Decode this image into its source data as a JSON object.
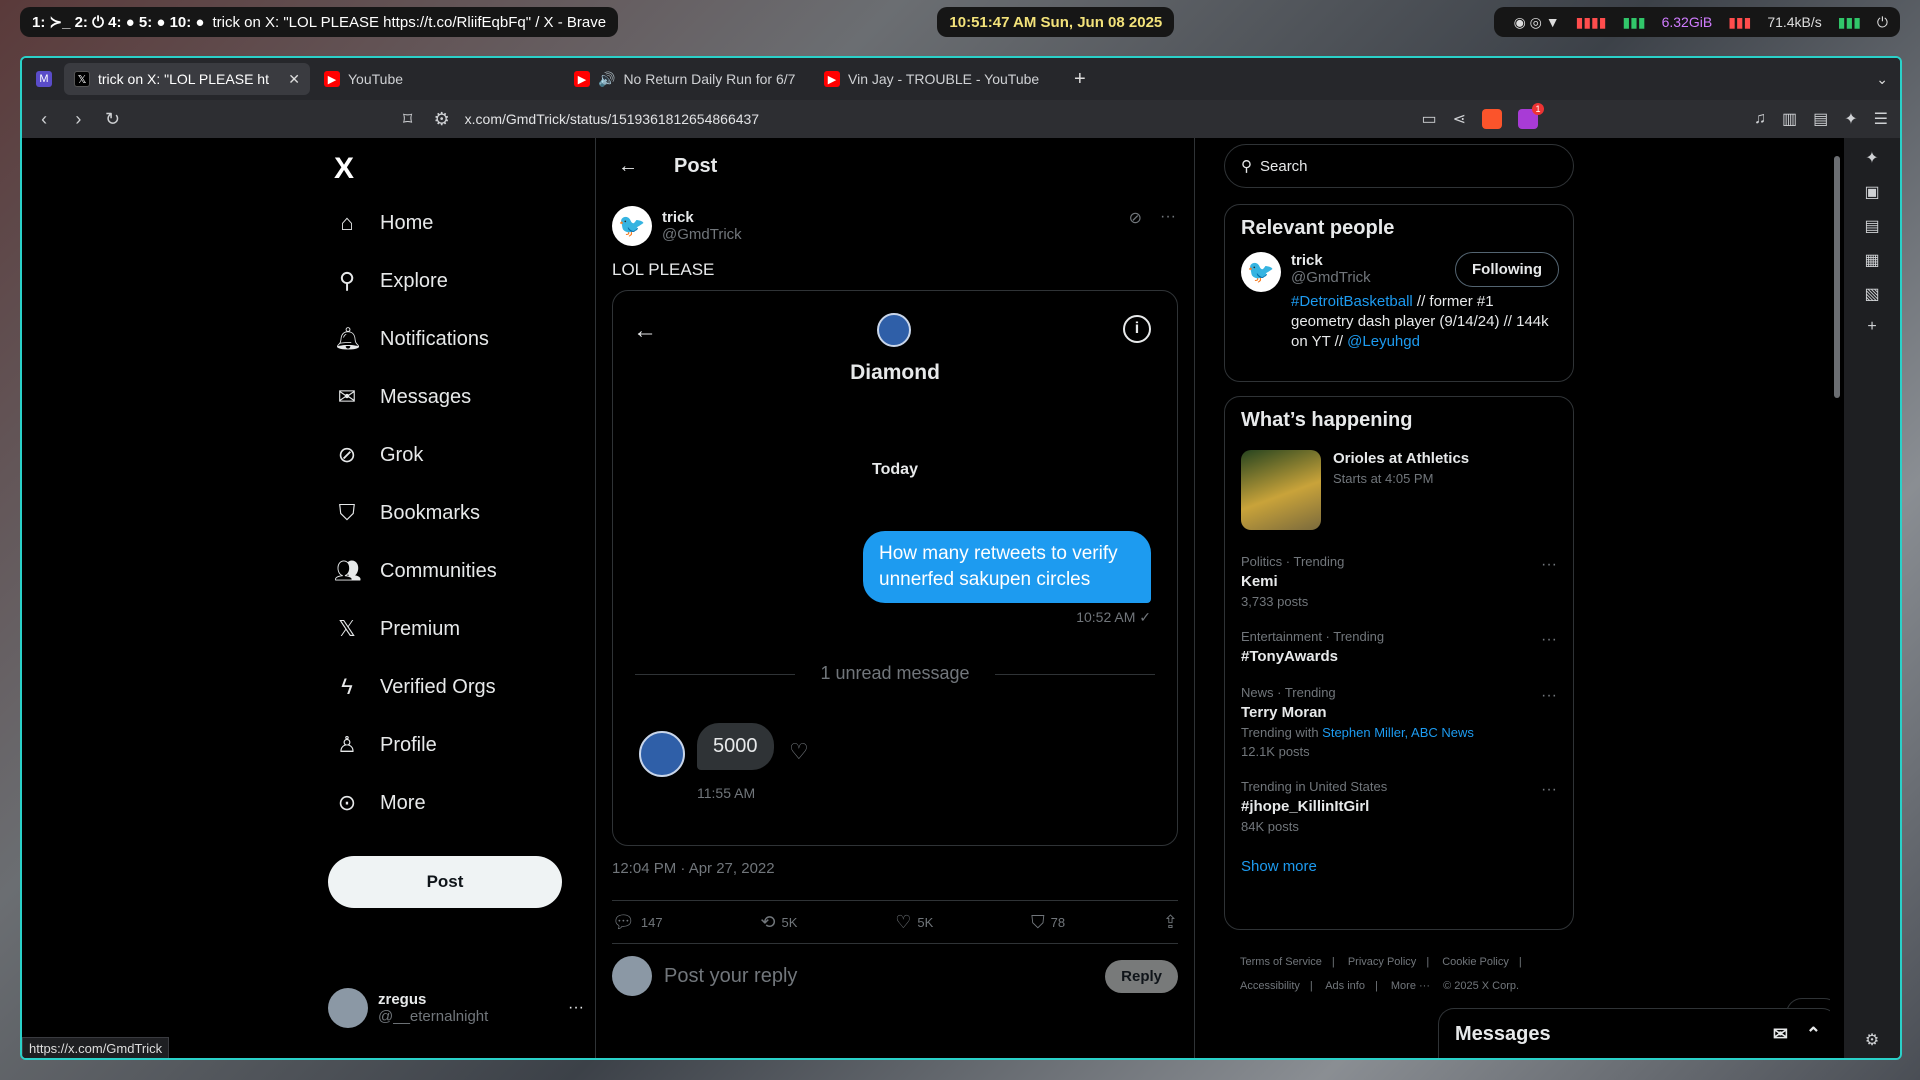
{
  "wm": {
    "workspaces": "1: ≻_ 2: ⏻ 4: ● 5: ● 10: ●",
    "window_title": "trick on X: \"LOL PLEASE https://t.co/RliifEqbFq\" / X - Brave",
    "clock": "10:51:47 AM Sun, Jun 08 2025",
    "mem": "6.32GiB",
    "net": "71.4kB/s"
  },
  "browser": {
    "tabs": [
      {
        "label": "trick on X: \"LOL PLEASE ht",
        "favicon": "x-icon"
      },
      {
        "label": "YouTube",
        "favicon": "youtube-icon"
      },
      {
        "label": "No Return Daily Run for 6/7",
        "favicon": "youtube-icon"
      },
      {
        "label": "Vin Jay - TROUBLE - YouTube",
        "favicon": "youtube-icon"
      }
    ],
    "url": "x.com/GmdTrick/status/1519361812654866437",
    "status_url": "https://x.com/GmdTrick"
  },
  "nav": {
    "logo": "X",
    "items": [
      "Home",
      "Explore",
      "Notifications",
      "Messages",
      "Grok",
      "Bookmarks",
      "Communities",
      "Premium",
      "Verified Orgs",
      "Profile",
      "More"
    ],
    "post_label": "Post",
    "me": {
      "name": "zregus",
      "handle": "@__eternalnight"
    }
  },
  "main": {
    "header_title": "Post",
    "author": {
      "name": "trick",
      "handle": "@GmdTrick"
    },
    "text": "LOL PLEASE",
    "embed": {
      "title": "Diamond",
      "today": "Today",
      "sent": "How many retweets to verify unnerfed sakupen circles",
      "sent_time": "10:52 AM ✓",
      "unread": "1 unread message",
      "received": "5000",
      "received_time": "11:55 AM"
    },
    "date": "12:04 PM · Apr 27, 2022",
    "stats": {
      "replies": "147",
      "reposts": "5K",
      "likes": "5K",
      "bookmarks": "78"
    },
    "reply_placeholder": "Post your reply",
    "reply_label": "Reply"
  },
  "right": {
    "search_placeholder": "Search",
    "relevant": {
      "title": "Relevant people",
      "name": "trick",
      "handle": "@GmdTrick",
      "follow_label": "Following",
      "bio_tag": "#DetroitBasketball",
      "bio_text": "// former #1 geometry dash player (9/14/24) // 144k on YT //",
      "bio_link": "@Leyuhgd"
    },
    "happening": {
      "title": "What’s happening",
      "game": {
        "title": "Orioles at Athletics",
        "sub": "Starts at 4:05 PM"
      },
      "trends": [
        {
          "meta": "Politics · Trending",
          "name": "Kemi",
          "with": "",
          "posts": "3,733 posts"
        },
        {
          "meta": "Entertainment · Trending",
          "name": "#TonyAwards",
          "with": "",
          "posts": ""
        },
        {
          "meta": "News · Trending",
          "name": "Terry Moran",
          "with": "Stephen Miller, ABC News",
          "posts": "12.1K posts"
        },
        {
          "meta": "Trending in United States",
          "name": "#jhope_KillinItGirl",
          "with": "",
          "posts": "84K posts"
        }
      ],
      "show_more": "Show more"
    },
    "footer": [
      "Terms of Service",
      "|",
      "Privacy Policy",
      "|",
      "Cookie Policy",
      "|",
      "Accessibility",
      "|",
      "Ads info",
      "|",
      "More ···",
      "© 2025 X Corp."
    ]
  },
  "messages_drawer": "Messages"
}
